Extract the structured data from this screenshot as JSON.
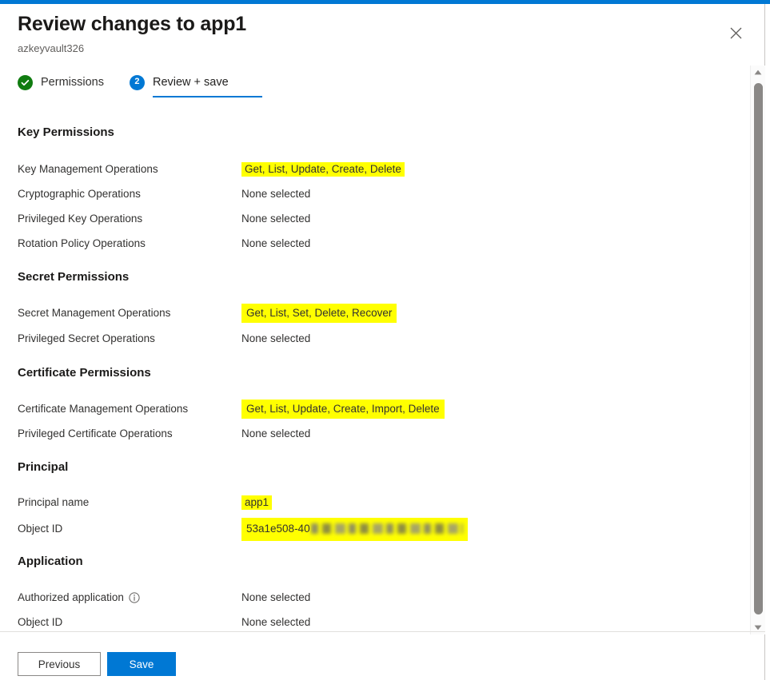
{
  "theme": {
    "accent": "#0078d4",
    "success_green": "#107c10",
    "highlight_yellow": "#ffff00",
    "text": "#323130",
    "subtle_text": "#605e5c"
  },
  "header": {
    "title": "Review changes to app1",
    "subtitle": "azkeyvault326",
    "close_icon": "close-icon"
  },
  "tabs": [
    {
      "label": "Permissions",
      "marker": "completed-check",
      "active": false
    },
    {
      "label": "Review + save",
      "marker": "2",
      "active": true
    }
  ],
  "sections": [
    {
      "title": "Key Permissions",
      "rows": [
        {
          "label": "Key Management Operations",
          "value": "Get, List, Update, Create, Delete",
          "highlighted": true
        },
        {
          "label": "Cryptographic Operations",
          "value": "None selected",
          "highlighted": false
        },
        {
          "label": "Privileged Key Operations",
          "value": "None selected",
          "highlighted": false
        },
        {
          "label": "Rotation Policy Operations",
          "value": "None selected",
          "highlighted": false
        }
      ]
    },
    {
      "title": "Secret Permissions",
      "rows": [
        {
          "label": "Secret Management Operations",
          "value": "Get, List, Set, Delete, Recover",
          "highlighted": true
        },
        {
          "label": "Privileged Secret Operations",
          "value": "None selected",
          "highlighted": false
        }
      ]
    },
    {
      "title": "Certificate Permissions",
      "rows": [
        {
          "label": "Certificate Management Operations",
          "value": "Get, List, Update, Create, Import, Delete",
          "highlighted": true
        },
        {
          "label": "Privileged Certificate Operations",
          "value": "None selected",
          "highlighted": false
        }
      ]
    },
    {
      "title": "Principal",
      "rows": [
        {
          "label": "Principal name",
          "value": "app1",
          "highlighted": true
        },
        {
          "label": "Object ID",
          "value": "53a1e508-40",
          "highlighted": true,
          "redacted": true
        }
      ]
    },
    {
      "title": "Application",
      "rows": [
        {
          "label": "Authorized application",
          "value": "None selected",
          "highlighted": false,
          "info_icon": true
        },
        {
          "label": "Object ID",
          "value": "None selected",
          "highlighted": false
        }
      ]
    }
  ],
  "footer": {
    "previous_label": "Previous",
    "save_label": "Save"
  },
  "scrollbar": {
    "up_icon": "chevron-up-icon",
    "down_icon": "chevron-down-icon"
  }
}
